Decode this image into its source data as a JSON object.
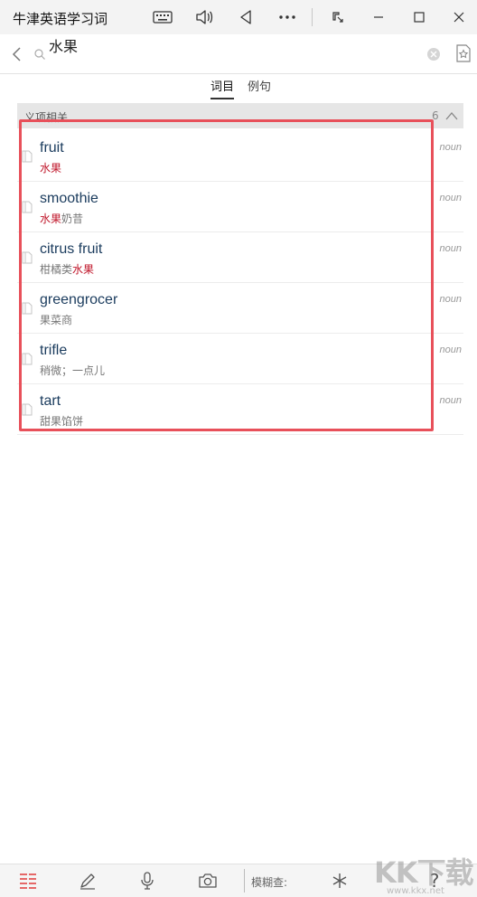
{
  "titlebar": {
    "title": "牛津英语学习词典"
  },
  "search": {
    "query": "水果",
    "placeholder": ""
  },
  "tabs": [
    {
      "label": "词目",
      "active": true
    },
    {
      "label": "例句",
      "active": false
    }
  ],
  "section": {
    "label": "义项相关",
    "count": "6"
  },
  "entries": [
    {
      "word": "fruit",
      "trans_pre": "",
      "trans_hl": "水果",
      "trans_post": "",
      "pos": "noun"
    },
    {
      "word": "smoothie",
      "trans_pre": "",
      "trans_hl": "水果",
      "trans_post": "奶昔",
      "pos": "noun"
    },
    {
      "word": "citrus fruit",
      "trans_pre": "柑橘类",
      "trans_hl": "水果",
      "trans_post": "",
      "pos": "noun"
    },
    {
      "word": "greengrocer",
      "trans_pre": "果菜商",
      "trans_hl": "",
      "trans_post": "",
      "pos": "noun"
    },
    {
      "word": "trifle",
      "trans_pre": "稍微；一点儿",
      "trans_hl": "",
      "trans_post": "",
      "pos": "noun"
    },
    {
      "word": "tart",
      "trans_pre": "甜果馅饼",
      "trans_hl": "",
      "trans_post": "",
      "pos": "noun"
    }
  ],
  "bottombar": {
    "fuzzy_label": "模糊查:",
    "help_label": "?"
  },
  "watermark": {
    "text": "KK下载",
    "sub": "www.kkx.net"
  },
  "colors": {
    "highlight": "#c0172b",
    "box": "#e8505a",
    "word": "#1a3b5d"
  }
}
